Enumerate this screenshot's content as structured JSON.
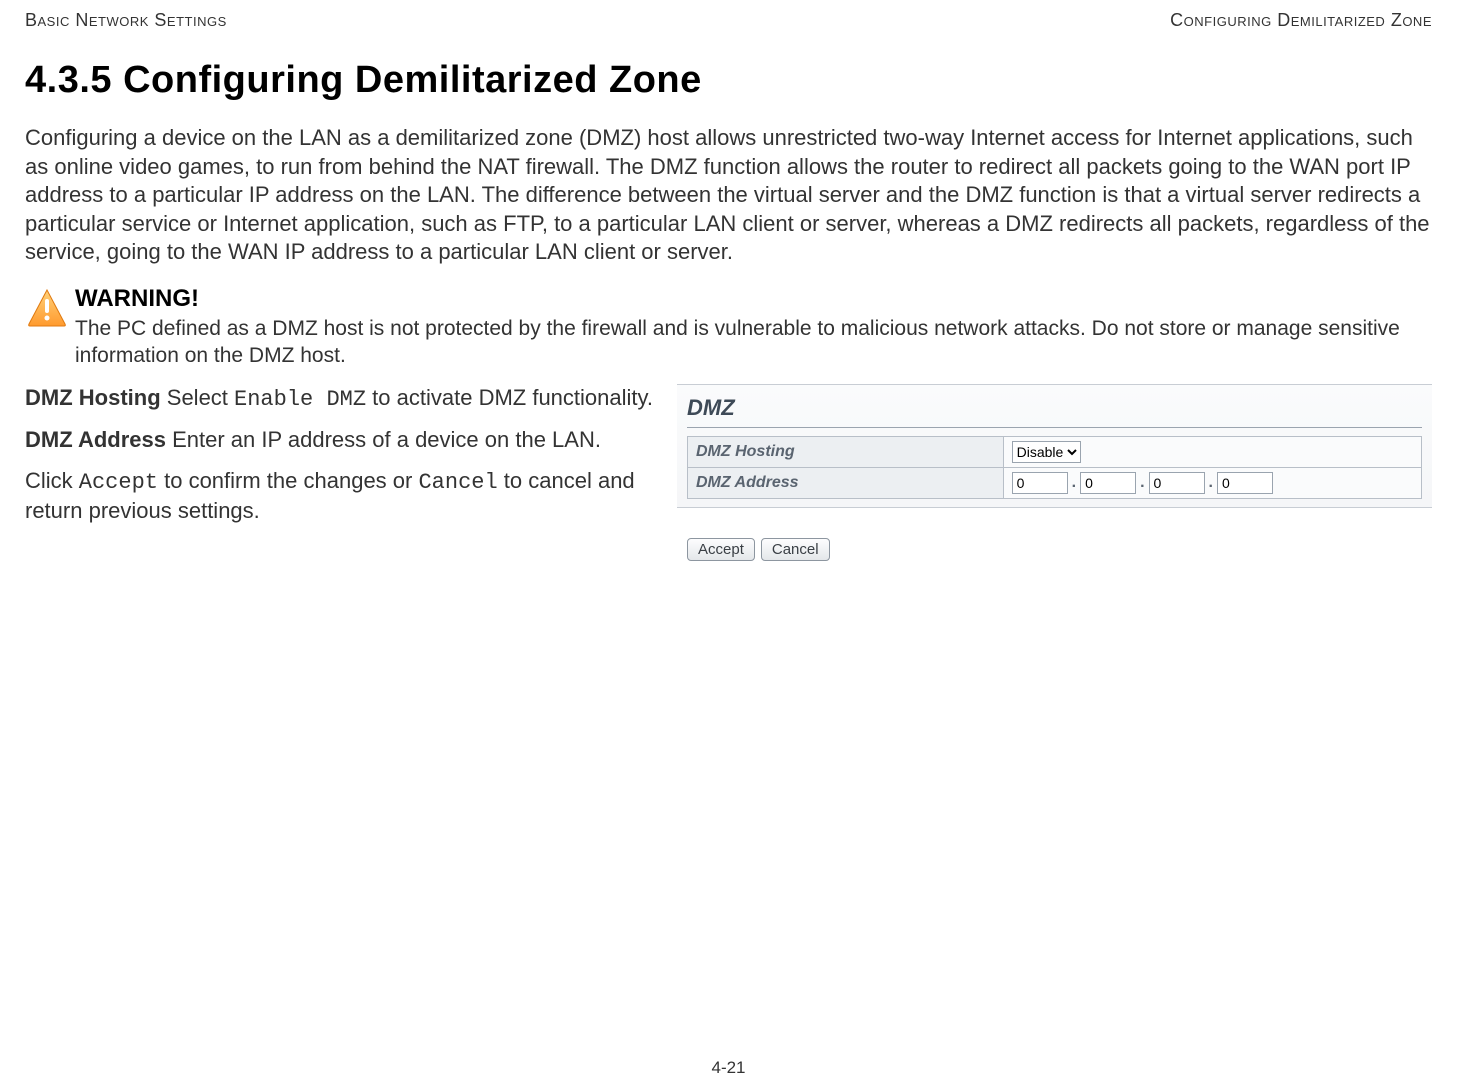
{
  "header": {
    "left": "Basic Network Settings",
    "right": "Configuring Demilitarized Zone"
  },
  "section": {
    "number": "4.3.5",
    "title": "Configuring Demilitarized Zone"
  },
  "intro": "Configuring a device on the LAN as a demilitarized zone (DMZ) host allows unrestricted two-way Internet access for Internet applications, such as online video games, to run from behind the NAT firewall. The DMZ function allows the router to redirect all packets going to the WAN port IP address to a particular IP address on the LAN. The difference between the virtual server and the DMZ function is that a virtual server redirects a particular service or Internet application, such as FTP, to a particular LAN client or server, whereas a DMZ redirects all packets, regardless of the service, going to the WAN IP address to a particular LAN client or server.",
  "warning": {
    "title": "WARNING!",
    "body": "The PC defined as a DMZ host is not protected by the firewall and is vulnerable to malicious network attacks. Do  not store or manage sensitive information on the DMZ host."
  },
  "fields": {
    "hosting": {
      "name": "DMZ Hosting",
      "pre": "  Select ",
      "code": "Enable DMZ",
      "post": " to activate DMZ functionality."
    },
    "address": {
      "name": "DMZ Address",
      "pre": "  Enter an IP address of a device on the LAN."
    },
    "action": {
      "pre": "Click ",
      "code1": "Accept",
      "mid": " to confirm the changes or ",
      "code2": "Cancel",
      "post": " to cancel and return previous settings."
    }
  },
  "panel": {
    "title": "DMZ",
    "rows": {
      "hosting_label": "DMZ Hosting",
      "hosting_value": "Disable",
      "address_label": "DMZ Address",
      "ip": {
        "o1": "0",
        "o2": "0",
        "o3": "0",
        "o4": "0"
      }
    },
    "buttons": {
      "accept": "Accept",
      "cancel": "Cancel"
    }
  },
  "page_number": "4-21"
}
